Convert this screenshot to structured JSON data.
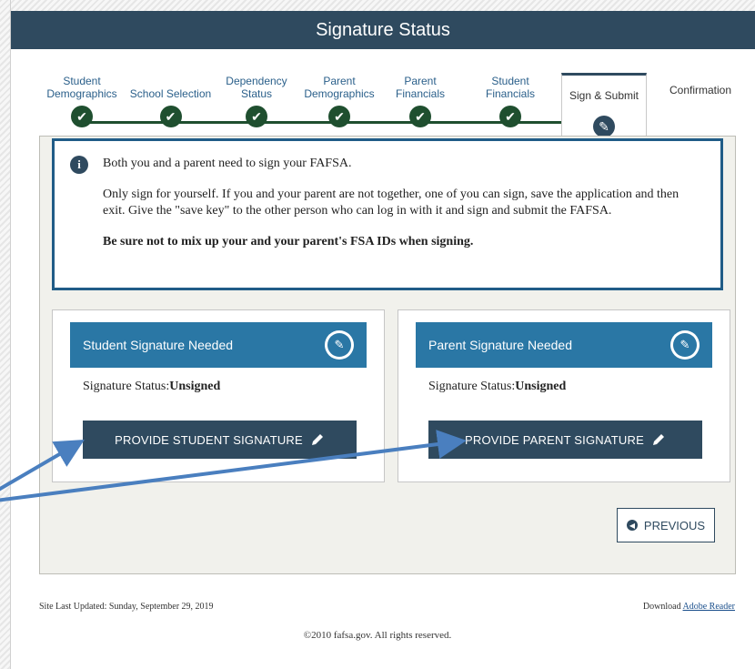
{
  "header": {
    "title": "Signature Status"
  },
  "steps": [
    {
      "label": "Student Demographics",
      "state": "complete"
    },
    {
      "label": "School Selection",
      "state": "complete"
    },
    {
      "label": "Dependency Status",
      "state": "complete"
    },
    {
      "label": "Parent Demographics",
      "state": "complete"
    },
    {
      "label": "Parent Financials",
      "state": "complete"
    },
    {
      "label": "Student Financials",
      "state": "complete"
    },
    {
      "label": "Sign & Submit",
      "state": "active"
    },
    {
      "label": "Confirmation",
      "state": "pending"
    }
  ],
  "info": {
    "line1": "Both you and a parent need to sign your FAFSA.",
    "line2": "Only sign for yourself. If you and your parent are not together, one of you can sign, save the application and then exit. Give the \"save key\" to the other person who can log in with it and sign and submit the FAFSA.",
    "line3": "Be sure not to mix up your and your parent's FSA IDs when signing."
  },
  "student_card": {
    "title": "Student Signature Needed",
    "status_label": "Signature Status:",
    "status_value": "Unsigned",
    "button_label": "PROVIDE STUDENT SIGNATURE"
  },
  "parent_card": {
    "title": "Parent Signature Needed",
    "status_label": "Signature Status:",
    "status_value": "Unsigned",
    "button_label": "PROVIDE PARENT SIGNATURE"
  },
  "previous_label": "PREVIOUS",
  "footer": {
    "last_updated": "Site Last Updated: Sunday, September 29, 2019",
    "download_prefix": "Download ",
    "download_link": "Adobe Reader",
    "copyright": "©2010 fafsa.gov. All rights reserved."
  },
  "colors": {
    "header": "#2f4a5f",
    "accent": "#2a77a5",
    "complete": "#1f4f2f",
    "arrow": "#4a7fbf"
  }
}
